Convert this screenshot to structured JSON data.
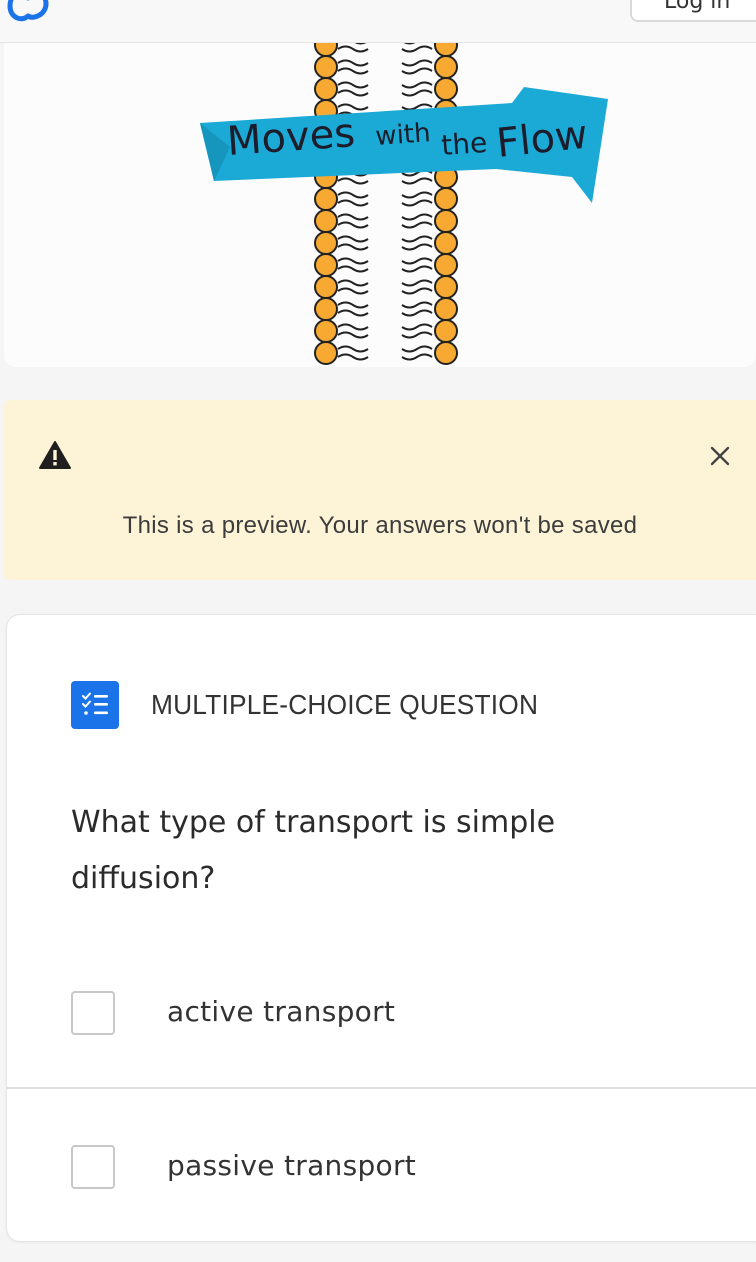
{
  "header": {
    "login_label": "Log in",
    "logo_icon": "brand-logo-icon"
  },
  "hero": {
    "banner_words": [
      "Moves",
      "with",
      "the",
      "Flow"
    ],
    "banner_color": "#1ba9d6",
    "lipid_head_color": "#f7a932"
  },
  "notice": {
    "icon": "warning-icon",
    "text": "This is a preview. Your answers won't be saved",
    "close_icon": "close-icon",
    "background": "#fdf4d8"
  },
  "question": {
    "type_icon": "checklist-icon",
    "type_label": "MULTIPLE-CHOICE QUESTION",
    "text": "What type of transport is simple diffusion?",
    "accent": "#1a73e8",
    "options": [
      {
        "label": "active transport",
        "checked": false
      },
      {
        "label": "passive transport",
        "checked": false
      }
    ]
  }
}
